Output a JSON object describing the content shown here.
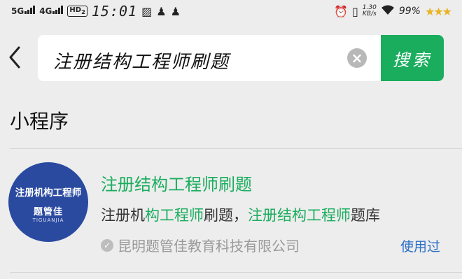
{
  "status_bar": {
    "network_1": "5G",
    "network_2": "4G",
    "hd_label": "HD",
    "hd_sub": "2",
    "time": "15:01",
    "speed_value": "1.30",
    "speed_unit": "KB/s",
    "battery": "99%"
  },
  "search": {
    "query": "注册结构工程师刷题",
    "search_label": "搜索"
  },
  "section": {
    "title": "小程序"
  },
  "result": {
    "avatar_text": "注册机构工程师",
    "avatar_brand": "题管佳",
    "avatar_sub": "TIGUANJIA",
    "title": "注册结构工程师刷题",
    "desc_1": "注册机",
    "desc_2": "构工程师",
    "desc_3": "刷题，",
    "desc_4": "注册结构工程师",
    "desc_5": "题库",
    "company": "昆明题管佳教育科技有限公司",
    "used_label": "使用过"
  }
}
